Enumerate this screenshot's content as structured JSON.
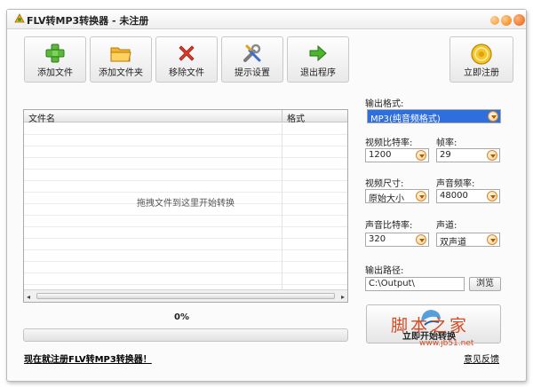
{
  "window": {
    "title": "FLV转MP3转换器 - 未注册"
  },
  "toolbar": {
    "add_file": "添加文件",
    "add_folder": "添加文件夹",
    "remove_file": "移除文件",
    "settings": "提示设置",
    "exit": "退出程序",
    "register": "立即注册"
  },
  "file_list": {
    "col_name": "文件名",
    "col_format": "格式",
    "drop_hint": "拖拽文件到这里开始转换"
  },
  "progress": {
    "percent_text": "0%",
    "value": 0
  },
  "register_link": "现在就注册FLV转MP3转换器！",
  "settings": {
    "output_format_label": "输出格式:",
    "output_format_value": "MP3(纯音频格式)",
    "video_bitrate_label": "视频比特率:",
    "video_bitrate_value": "1200",
    "frame_rate_label": "帧率:",
    "frame_rate_value": "29",
    "video_size_label": "视频尺寸:",
    "video_size_value": "原始大小",
    "sample_rate_label": "声音频率:",
    "sample_rate_value": "48000",
    "audio_bitrate_label": "声音比特率:",
    "audio_bitrate_value": "320",
    "channel_label": "声道:",
    "channel_value": "双声道",
    "output_path_label": "输出路径:",
    "output_path_value": "C:\\Output\\",
    "browse": "浏览"
  },
  "convert_button": "立即开始转换",
  "feedback_link": "意见反馈",
  "watermark": {
    "text": "脚本之家",
    "url": "www.jb51.net"
  },
  "colors": {
    "accent_orange": "#ef7d10",
    "selection_blue": "#2f6fdd",
    "watermark_red": "#d44a22"
  }
}
